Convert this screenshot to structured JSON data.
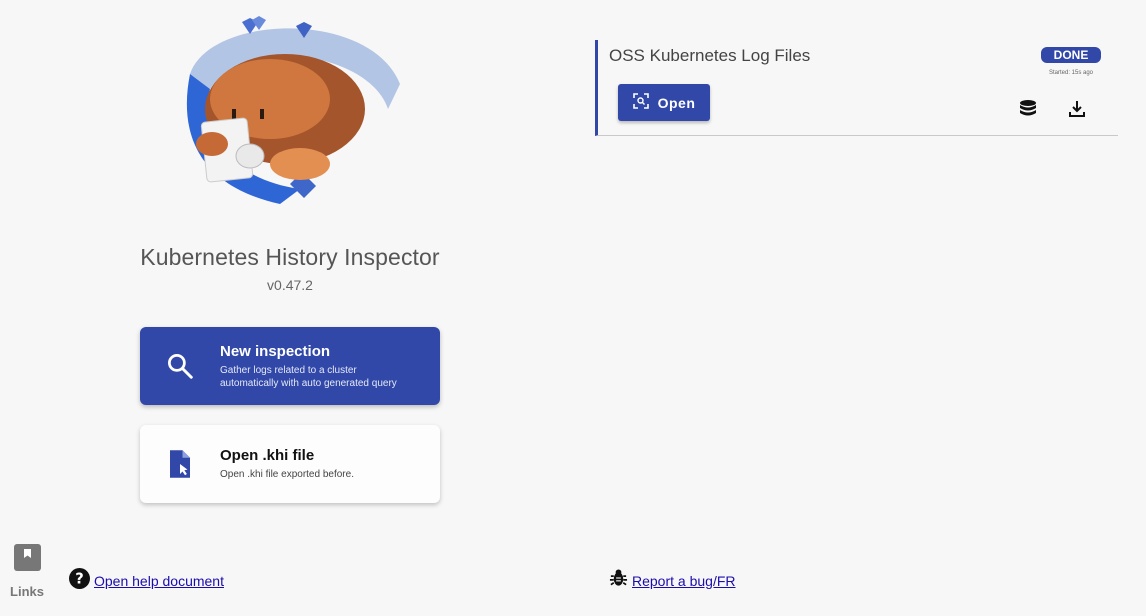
{
  "app": {
    "title": "Kubernetes History Inspector",
    "version": "v0.47.2"
  },
  "actions": {
    "new_inspection": {
      "title": "New inspection",
      "description_line1": "Gather logs related to a cluster",
      "description_line2": "automatically with auto generated query",
      "icon": "search-icon"
    },
    "open_file": {
      "title": "Open .khi file",
      "description": "Open .khi file exported before.",
      "icon": "file-open-icon"
    }
  },
  "task": {
    "title": "OSS Kubernetes Log Files",
    "status": "DONE",
    "started": "Started: 15s ago",
    "open_label": "Open",
    "icons": [
      "database-icon",
      "download-icon"
    ]
  },
  "footer": {
    "links_label": "Links",
    "help_link": "Open help document",
    "bug_link": "Report a bug/FR"
  },
  "colors": {
    "primary": "#3148a8",
    "background": "#f7f7f7"
  }
}
